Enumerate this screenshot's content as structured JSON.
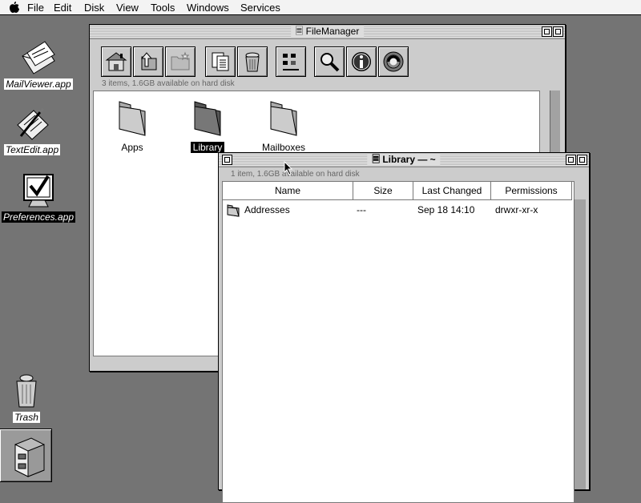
{
  "menubar": {
    "apple_icon": "apple-icon",
    "items": [
      "File",
      "Edit",
      "Disk",
      "View",
      "Tools",
      "Windows",
      "Services"
    ]
  },
  "desktop": {
    "icons": [
      {
        "label": "MailViewer.app",
        "icon": "mail-icon"
      },
      {
        "label": "TextEdit.app",
        "icon": "text-edit-icon"
      },
      {
        "label": "Preferences.app",
        "icon": "preferences-icon",
        "selected": true
      },
      {
        "label": "Trash",
        "icon": "trash-icon"
      }
    ],
    "dock_icon": "file-cabinet-icon"
  },
  "filemanager": {
    "title": "FileManager",
    "status": "3 items, 1.6GB available on hard disk",
    "toolbar": [
      "home-icon",
      "up-icon",
      "new-folder-icon",
      "copy-icon",
      "trash-icon",
      "view-icon",
      "search-icon",
      "info-icon",
      "spinner-icon"
    ],
    "items": [
      {
        "label": "Apps",
        "selected": false
      },
      {
        "label": "Library",
        "selected": true
      },
      {
        "label": "Mailboxes",
        "selected": false
      }
    ]
  },
  "library": {
    "title": "Library",
    "title_suffix": "— ~",
    "status": "1 item, 1.6GB available on hard disk",
    "columns": [
      "Name",
      "Size",
      "Last Changed",
      "Permissions"
    ],
    "rows": [
      {
        "name": "Addresses",
        "size": "---",
        "changed": "Sep 18 14:10",
        "permissions": "drwxr-xr-x"
      }
    ]
  }
}
